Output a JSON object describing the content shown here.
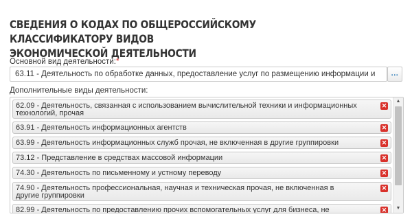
{
  "section": {
    "title_line1": "СВЕДЕНИЯ О КОДАХ ПО ОБЩЕРОССИЙСКОМУ КЛАССИФИКАТОРУ ВИДОВ",
    "title_line2": "ЭКОНОМИЧЕСКОЙ ДЕЯТЕЛЬНОСТИ"
  },
  "main_activity": {
    "label": "Основной вид деятельности:",
    "required_mark": "*",
    "value": "63.11 - Деятельность по обработке данных, предоставление услуг по размещению информации и",
    "browse_button": "...",
    "browse_color": "#2a7ab8"
  },
  "additional_activities": {
    "label": "Дополнительные виды деятельности:",
    "remove_icon": "close-icon",
    "remove_color": "#d9312b",
    "items": [
      {
        "line1": "62.09 - Деятельность, связанная с использованием вычислительной техники и информационных",
        "line2": "технологий, прочая"
      },
      {
        "line1": "63.91 - Деятельность информационных агентств",
        "line2": ""
      },
      {
        "line1": "63.99 - Деятельность информационных служб прочая, не включенная в другие группировки",
        "line2": ""
      },
      {
        "line1": "73.12 - Представление в средствах массовой информации",
        "line2": ""
      },
      {
        "line1": "74.30 - Деятельность по письменному и устному переводу",
        "line2": ""
      },
      {
        "line1": "74.90 - Деятельность профессиональная, научная и техническая прочая, не включенная в",
        "line2": "другие группировки"
      },
      {
        "line1": "82.99 - Деятельность по предоставлению прочих вспомогательных услуг для бизнеса, не",
        "line2": ""
      }
    ]
  }
}
